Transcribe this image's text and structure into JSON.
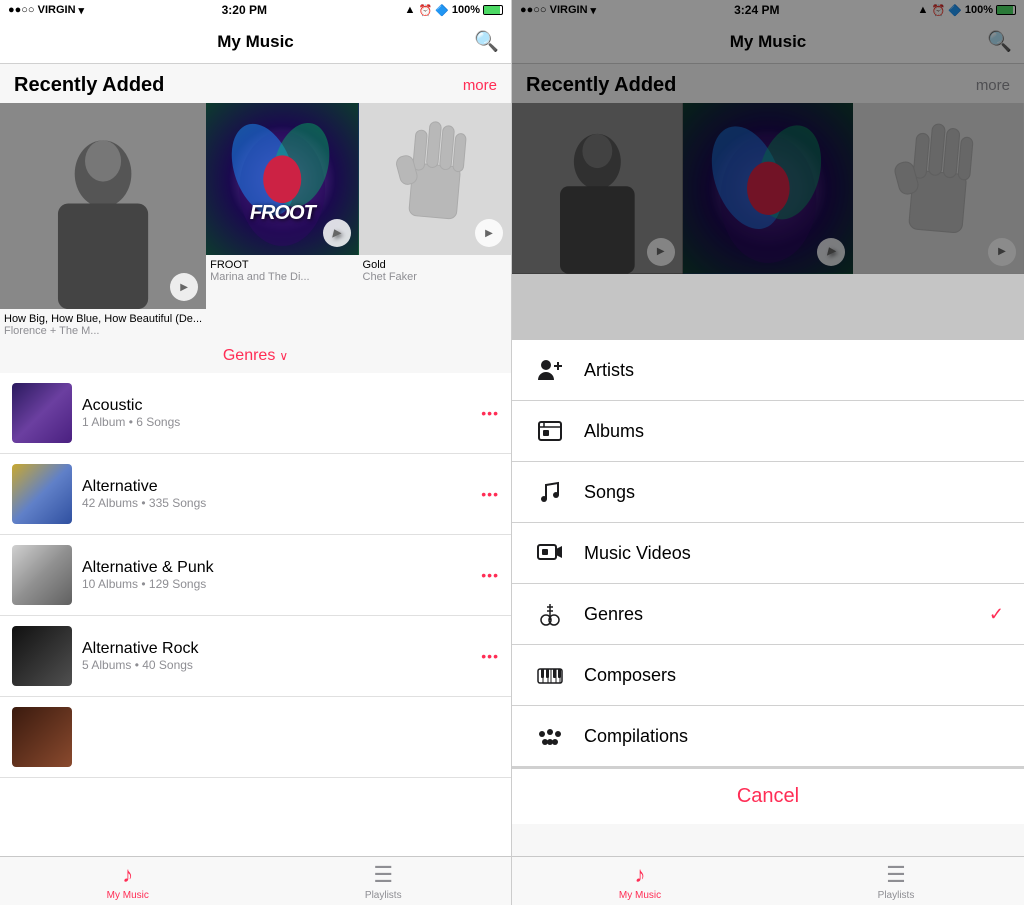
{
  "left": {
    "status": {
      "carrier": "●●○○ VIRGIN",
      "wifi": "WiFi",
      "time": "3:20 PM",
      "location": "▲",
      "battery_pct": "100%"
    },
    "nav": {
      "title": "My Music",
      "search_label": "Search"
    },
    "recently_added": {
      "label": "Recently Added",
      "more": "more"
    },
    "albums": [
      {
        "name": "How Big, How Blue, How Beautiful (De...",
        "artist": "Florence + The M...",
        "cover_type": "florence"
      },
      {
        "name": "FROOT",
        "artist": "Marina and The Di...",
        "cover_type": "marina"
      },
      {
        "name": "Gold",
        "artist": "Chet Faker",
        "cover_type": "chet"
      }
    ],
    "genre_selector": {
      "label": "Genres",
      "chevron": "∨"
    },
    "genres": [
      {
        "name": "Acoustic",
        "sub": "1 Album • 6 Songs",
        "thumb": "acoustic"
      },
      {
        "name": "Alternative",
        "sub": "42 Albums • 335 Songs",
        "thumb": "alternative"
      },
      {
        "name": "Alternative & Punk",
        "sub": "10 Albums • 129 Songs",
        "thumb": "alt-punk"
      },
      {
        "name": "Alternative Rock",
        "sub": "5 Albums • 40 Songs",
        "thumb": "alt-rock"
      }
    ],
    "tabs": [
      {
        "label": "My Music",
        "icon": "♪",
        "active": true
      },
      {
        "label": "Playlists",
        "icon": "☰",
        "active": false
      }
    ]
  },
  "right": {
    "status": {
      "carrier": "●●○○ VIRGIN",
      "time": "3:24 PM",
      "battery_pct": "100%"
    },
    "nav": {
      "title": "My Music"
    },
    "recently_added": {
      "label": "Recently Added",
      "more": "more"
    },
    "action_sheet": {
      "items": [
        {
          "id": "artists",
          "label": "Artists",
          "icon": "artists",
          "checked": false
        },
        {
          "id": "albums",
          "label": "Albums",
          "icon": "albums",
          "checked": false
        },
        {
          "id": "songs",
          "label": "Songs",
          "icon": "songs",
          "checked": false
        },
        {
          "id": "music-videos",
          "label": "Music Videos",
          "icon": "music-videos",
          "checked": false
        },
        {
          "id": "genres",
          "label": "Genres",
          "icon": "genres",
          "checked": true
        },
        {
          "id": "composers",
          "label": "Composers",
          "icon": "composers",
          "checked": false
        },
        {
          "id": "compilations",
          "label": "Compilations",
          "icon": "compilations",
          "checked": false
        }
      ],
      "cancel_label": "Cancel"
    },
    "tabs": [
      {
        "label": "My Music",
        "icon": "♪",
        "active": true
      },
      {
        "label": "Playlists",
        "icon": "☰",
        "active": false
      }
    ]
  }
}
